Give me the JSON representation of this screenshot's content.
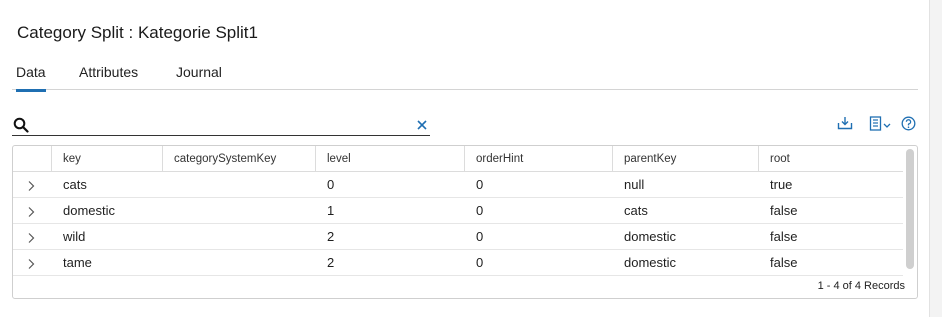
{
  "page": {
    "title": "Category Split : Kategorie Split1"
  },
  "tabs": [
    {
      "label": "Data",
      "active": true
    },
    {
      "label": "Attributes",
      "active": false
    },
    {
      "label": "Journal",
      "active": false
    }
  ],
  "search": {
    "value": "",
    "placeholder": ""
  },
  "toolbar": {
    "icons": [
      "download-icon",
      "column-chooser-icon",
      "help-icon"
    ],
    "accent_color": "#1f6fb2"
  },
  "grid": {
    "columns": [
      "key",
      "categorySystemKey",
      "level",
      "orderHint",
      "parentKey",
      "root"
    ],
    "rows": [
      {
        "key": "cats",
        "categorySystemKey": "",
        "level": "0",
        "orderHint": "0",
        "parentKey": "null",
        "root": "true"
      },
      {
        "key": "domestic",
        "categorySystemKey": "",
        "level": "1",
        "orderHint": "0",
        "parentKey": "cats",
        "root": "false"
      },
      {
        "key": "wild",
        "categorySystemKey": "",
        "level": "2",
        "orderHint": "0",
        "parentKey": "domestic",
        "root": "false"
      },
      {
        "key": "tame",
        "categorySystemKey": "",
        "level": "2",
        "orderHint": "0",
        "parentKey": "domestic",
        "root": "false"
      }
    ],
    "footer": "1 - 4 of 4 Records"
  }
}
